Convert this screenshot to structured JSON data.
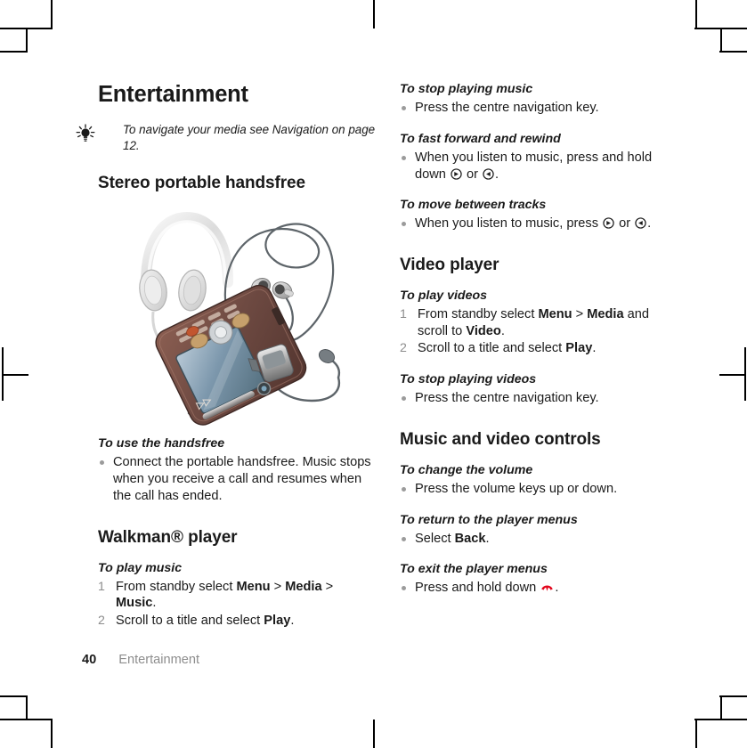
{
  "document": {
    "chapter_title": "Entertainment",
    "footer": {
      "page_number": "40",
      "chapter_label": "Entertainment"
    }
  },
  "tip": {
    "icon": "lightbulb-icon",
    "text": "To navigate your media see Navigation on page 12."
  },
  "left_column": {
    "sections": [
      {
        "heading": "Stereo portable handsfree",
        "illustration": "stereo-portable-handsfree-illustration",
        "tasks": [
          {
            "title": "To use the handsfree",
            "type": "bullets",
            "items": [
              "Connect the portable handsfree. Music stops when you receive a call and resumes when the call has ended."
            ]
          }
        ]
      },
      {
        "heading": "Walkman® player",
        "tasks": [
          {
            "title": "To play music",
            "type": "steps",
            "items": [
              "From standby select Menu > Media > Music.",
              "Scroll to a title and select Play."
            ]
          }
        ]
      }
    ]
  },
  "right_column": {
    "sections": [
      {
        "heading": "",
        "tasks": [
          {
            "title": "To stop playing music",
            "type": "bullets",
            "items": [
              "Press the centre navigation key."
            ]
          },
          {
            "title": "To fast forward and rewind",
            "type": "bullets",
            "items": [
              "When you listen to music, press and hold down  or  ."
            ]
          },
          {
            "title": "To move between tracks",
            "type": "bullets",
            "items": [
              "When you listen to music, press  or  ."
            ]
          }
        ]
      },
      {
        "heading": "Video player",
        "tasks": [
          {
            "title": "To play videos",
            "type": "steps",
            "items": [
              "From standby select Menu > Media and scroll to Video.",
              "Scroll to a title and select Play."
            ]
          },
          {
            "title": "To stop playing videos",
            "type": "bullets",
            "items": [
              "Press the centre navigation key."
            ]
          }
        ]
      },
      {
        "heading": "Music and video controls",
        "tasks": [
          {
            "title": "To change the volume",
            "type": "bullets",
            "items": [
              "Press the volume keys up or down."
            ]
          },
          {
            "title": "To return to the player menus",
            "type": "bullets",
            "items": [
              "Select Back."
            ]
          },
          {
            "title": "To exit the player menus",
            "type": "bullets",
            "items": [
              "Press and hold down  ."
            ]
          }
        ]
      }
    ]
  },
  "inline_terms": {
    "menu": "Menu",
    "media": "Media",
    "music": "Music",
    "video": "Video",
    "play": "Play",
    "back": "Back",
    "separator": ">"
  },
  "icons": {
    "forward_key": "circled-right-arrow-icon",
    "rewind_key": "circled-left-arrow-icon",
    "end_call_key": "end-call-icon"
  },
  "colors": {
    "text": "#1a1a1a",
    "muted": "#8d8d8d",
    "bullet": "#9b9b9b",
    "end_call_red": "#e3051b",
    "phone_body": "#6e4a42",
    "phone_screen": "#8aa3b5"
  }
}
